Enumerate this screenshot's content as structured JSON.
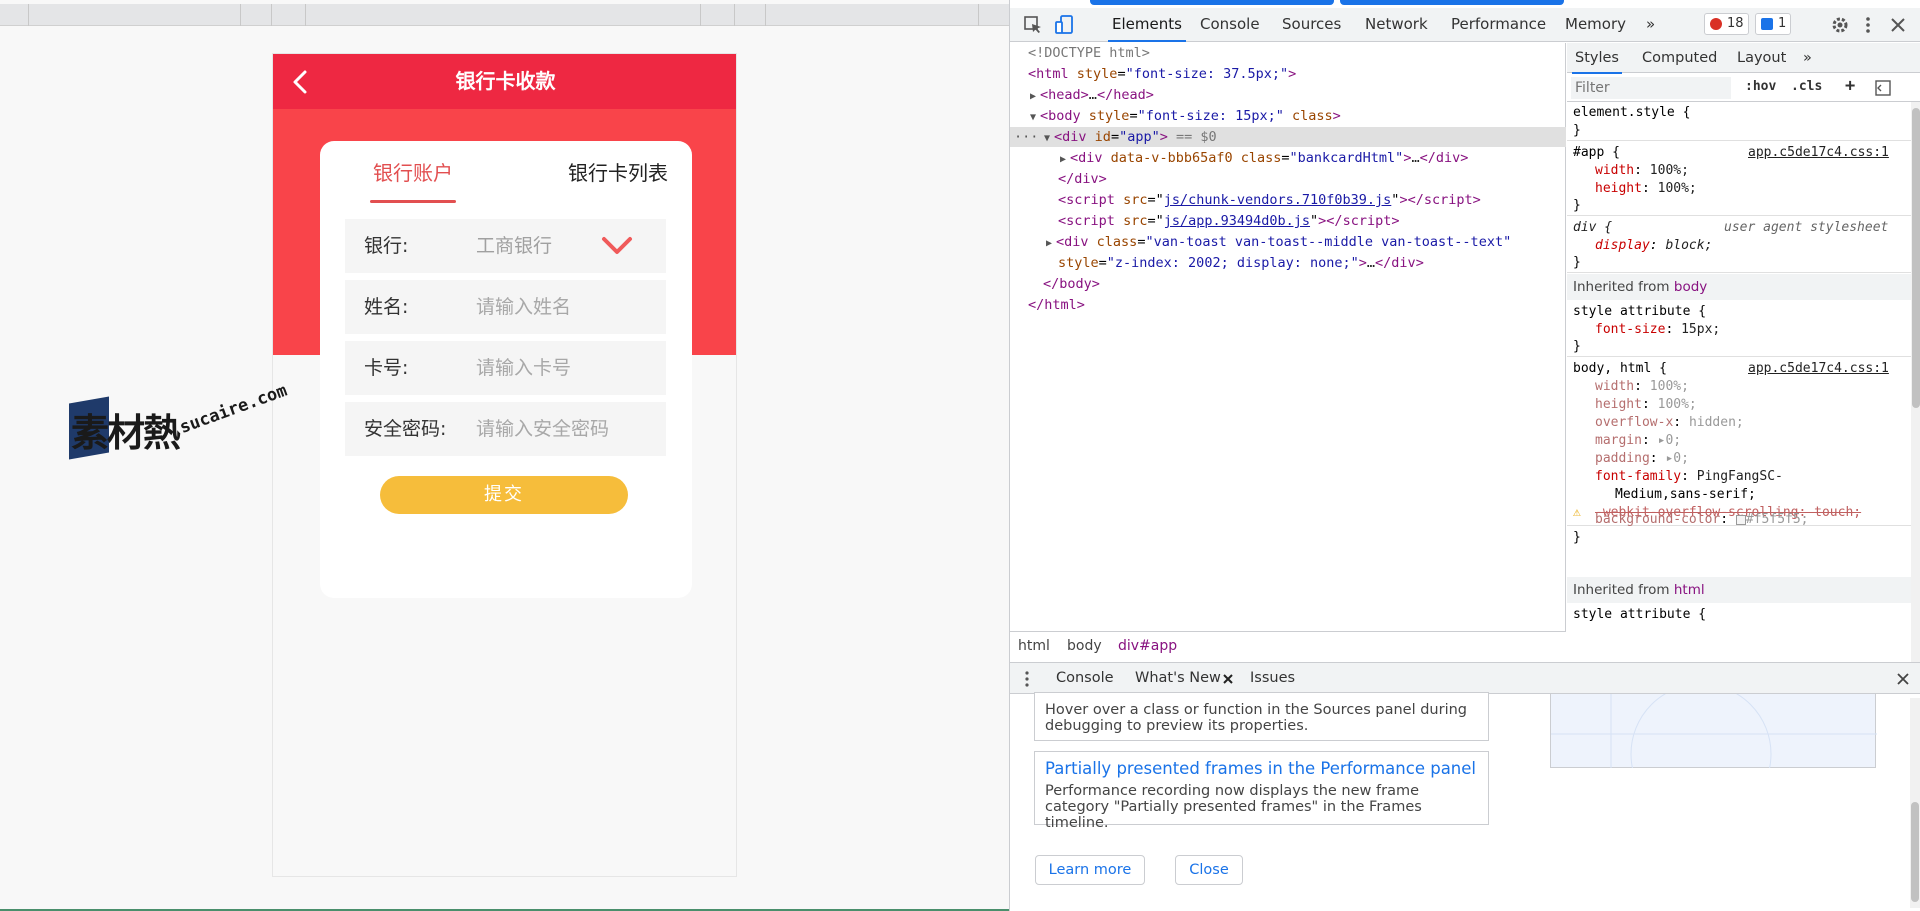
{
  "app": {
    "header_title": "银行卡收款",
    "tabs": [
      "银行账户",
      "银行卡列表"
    ],
    "form": {
      "bank_label": "银行:",
      "bank_value": "工商银行",
      "name_label": "姓名:",
      "name_placeholder": "请输入姓名",
      "card_label": "卡号:",
      "card_placeholder": "请输入卡号",
      "password_label": "安全密码:",
      "password_placeholder": "请输入安全密码"
    },
    "submit_label": "提交",
    "colors": {
      "header": "#ee2842",
      "band": "#f9444a",
      "accent": "#e24f50",
      "submit": "#f6bd3b"
    }
  },
  "watermark": {
    "cn": "素材熱",
    "en": "sucaire.com"
  },
  "devtools": {
    "tabs": [
      "Elements",
      "Console",
      "Sources",
      "Network",
      "Performance",
      "Memory"
    ],
    "more": "»",
    "error_count": "18",
    "message_count": "1",
    "elements": {
      "doctype": "<!DOCTYPE html>",
      "html_open": "html",
      "html_attr": "style",
      "html_val": "\"font-size: 37.5px;\"",
      "head": "head",
      "head_ellipsis": "…",
      "body": "body",
      "body_attr": "style",
      "body_val": "\"font-size: 15px;\"",
      "body_attr2": "class",
      "div_app": "div",
      "div_app_attr": "id",
      "div_app_val": "\"app\"",
      "eq_marker": "== $0",
      "bank_div": "div",
      "bank_attr1": "data-v-bbb65af0",
      "bank_attr2": "class",
      "bank_val2": "\"bankcardHtml\"",
      "bank_ellipsis": "…",
      "div_close": "div",
      "script": "script",
      "src_attr": "src",
      "script1_src": "js/chunk-vendors.710f0b39.js",
      "script2_src": "js/app.93494d0b.js",
      "toast_div": "div",
      "toast_class_attr": "class",
      "toast_class_val": "\"van-toast van-toast--middle van-toast--text\"",
      "toast_style_attr": "style",
      "toast_style_val": "\"z-index: 2002; display: none;\"",
      "toast_ellipsis": "…",
      "body_close": "body",
      "html_close": "html"
    },
    "breadcrumbs": [
      "html",
      "body",
      "div#app"
    ],
    "styles": {
      "tabs": [
        "Styles",
        "Computed",
        "Layout"
      ],
      "more": "»",
      "filter_placeholder": "Filter",
      "hov": ":hov",
      "cls": ".cls",
      "plus": "+",
      "element_style": "element.style {",
      "brace_close": "}",
      "app_selector": "#app {",
      "app_source": "app.c5de17c4.css:1",
      "width_prop": "width",
      "width_val": "100%;",
      "height_prop": "height",
      "height_val": "100%;",
      "div_selector": "div {",
      "ua_label": "user agent stylesheet",
      "display_prop": "display",
      "display_val": "block;",
      "inherited_body_prefix": "Inherited from",
      "inherited_body_tag": "body",
      "style_attr_rule": "style attribute {",
      "font_size_prop": "font-size",
      "font_size_val": "15px;",
      "body_html_selector": "body, html {",
      "body_html_source": "app.c5de17c4.css:1",
      "overflow_prop": "overflow-x",
      "overflow_val": "hidden;",
      "margin_prop": "margin",
      "margin_val": "0;",
      "padding_prop": "padding",
      "padding_val": "0;",
      "font_family_prop": "font-family",
      "font_family_val": "PingFangSC-",
      "font_family_val2": "Medium,sans-serif;",
      "webkit_line": "-webkit-overflow-scrolling: touch;",
      "bg_prop": "background-color",
      "bg_val": "#f5f5f5;",
      "inherited_html_tag": "html",
      "style_attr_rule2": "style attribute {"
    },
    "drawer": {
      "tabs": [
        "Console",
        "What's New",
        "Issues"
      ],
      "item1_body_1": "Hover over a class or function in the Sources panel during",
      "item1_body_2": "debugging to preview its properties.",
      "item2_title": "Partially presented frames in the Performance panel",
      "item2_body_1": "Performance recording now displays the new frame",
      "item2_body_2": "category \"Partially presented frames\" in the Frames timeline.",
      "learn_more": "Learn more",
      "close": "Close"
    }
  }
}
